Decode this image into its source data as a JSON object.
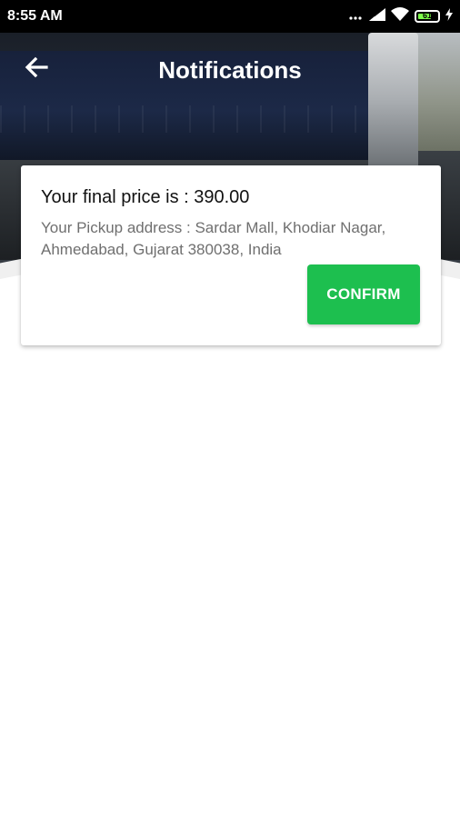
{
  "status_bar": {
    "time": "8:55 AM",
    "battery_level": "61",
    "icons": [
      "signal-dots-icon",
      "cellular-signal-icon",
      "wifi-icon",
      "battery-icon",
      "charging-bolt-icon"
    ]
  },
  "header": {
    "title": "Notifications",
    "back_icon": "arrow-left-icon"
  },
  "notification": {
    "price": "Your final price is : 390.00",
    "address": "Your Pickup address : Sardar Mall, Khodiar Nagar, Ahmedabad, Gujarat 380038, India",
    "confirm_label": "CONFIRM"
  },
  "colors": {
    "confirm_button": "#1dbf4f",
    "status_bar": "#000000",
    "title_text": "#ffffff"
  }
}
